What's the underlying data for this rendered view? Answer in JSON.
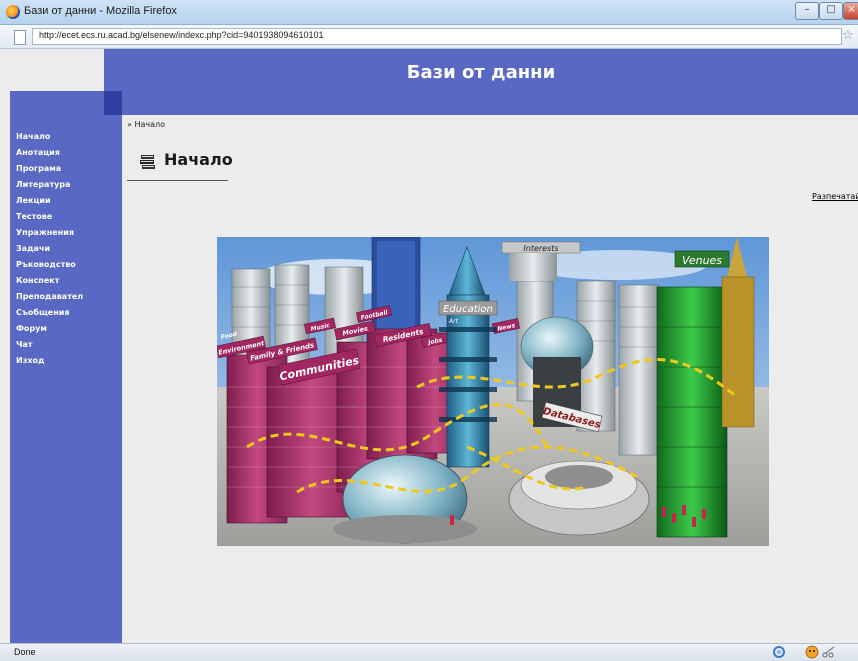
{
  "window": {
    "title": "Бази от данни - Mozilla Firefox",
    "url": "http://ecet.ecs.ru.acad.bg/elsenew/indexc.php?cid=9401938094610101"
  },
  "site": {
    "title": "Бази от данни"
  },
  "sidebar": {
    "items": [
      {
        "label": "Начало"
      },
      {
        "label": "Анотация"
      },
      {
        "label": "Програма"
      },
      {
        "label": "Литература"
      },
      {
        "label": "Лекции"
      },
      {
        "label": "Тестове"
      },
      {
        "label": "Упражнения"
      },
      {
        "label": "Задачи"
      },
      {
        "label": "Ръководство"
      },
      {
        "label": "Конспект"
      },
      {
        "label": "Преподавател"
      },
      {
        "label": "Съобщения"
      },
      {
        "label": "Форум"
      },
      {
        "label": "Чат"
      },
      {
        "label": "Изход"
      }
    ]
  },
  "main": {
    "breadcrumb": "» Начало",
    "heading": "Начало",
    "print_link": "Разпечатай",
    "hero": {
      "labels": {
        "communities": "Communities",
        "education": "Education",
        "databases": "Databases",
        "venues": "Venues",
        "interests": "Interests",
        "environment": "Environment",
        "family": "Family & Friends",
        "residents": "Residents",
        "music": "Music",
        "movies": "Movies",
        "football": "Football",
        "jobs": "Jobs",
        "news": "News",
        "art": "Art",
        "food": "Food"
      }
    }
  },
  "status": {
    "text": "Done"
  },
  "colors": {
    "brand": "#5968c2",
    "brand_dark": "#2f3ea0"
  }
}
